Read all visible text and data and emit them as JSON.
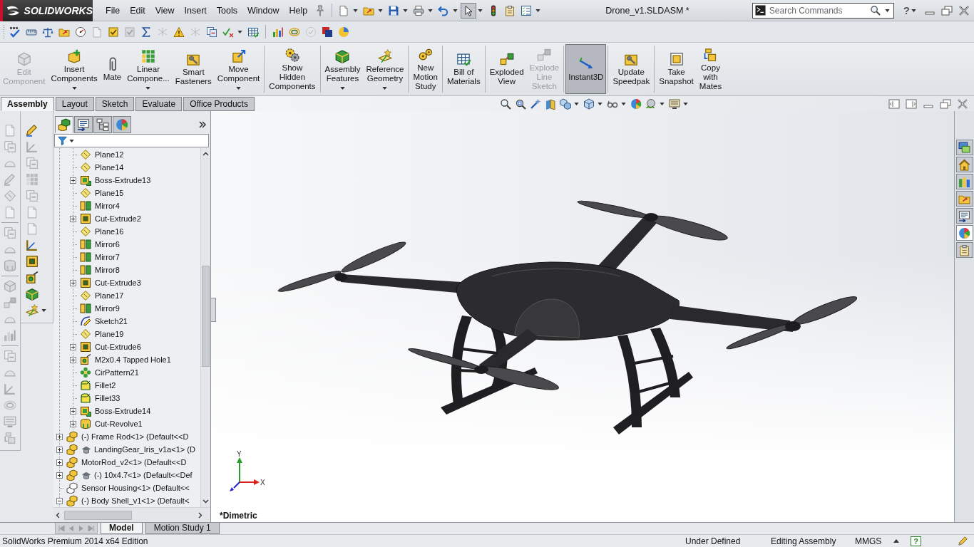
{
  "title_bar": {
    "logo": "SOLIDWORKS",
    "menu": [
      "File",
      "Edit",
      "View",
      "Insert",
      "Tools",
      "Window",
      "Help"
    ],
    "quick_access": [
      {
        "kind": "page",
        "dropdown": true,
        "selected": false
      },
      {
        "kind": "folder",
        "dropdown": true,
        "selected": false
      },
      {
        "kind": "floppy",
        "dropdown": true,
        "selected": false
      },
      {
        "kind": "printer",
        "dropdown": true,
        "selected": false
      },
      {
        "kind": "undo",
        "dropdown": true,
        "selected": false
      },
      {
        "kind": "cursor",
        "dropdown": true,
        "selected": true
      },
      {
        "kind": "lights",
        "dropdown": false,
        "selected": false
      },
      {
        "kind": "clipboard",
        "dropdown": false,
        "selected": false
      },
      {
        "kind": "checklist",
        "dropdown": true,
        "selected": false
      }
    ],
    "document_title": "Drone_v1.SLDASM *",
    "search": {
      "placeholder": "Search Commands"
    },
    "help": "?"
  },
  "toolbar": [
    [
      {
        "kind": "check",
        "disabled": false,
        "dropdown": false
      },
      {
        "kind": "ruler",
        "disabled": false,
        "dropdown": false
      },
      {
        "kind": "scale",
        "disabled": false,
        "dropdown": false
      },
      {
        "kind": "folder",
        "disabled": false,
        "dropdown": false
      },
      {
        "kind": "gauge",
        "disabled": false,
        "dropdown": false
      },
      {
        "kind": "page",
        "disabled": true,
        "dropdown": false
      },
      {
        "kind": "checkbox",
        "disabled": false,
        "dropdown": false
      },
      {
        "kind": "checkbox",
        "disabled": true,
        "dropdown": false
      },
      {
        "kind": "sigma",
        "disabled": false,
        "dropdown": false
      },
      {
        "kind": "lines",
        "disabled": true,
        "dropdown": false
      },
      {
        "kind": "warning",
        "disabled": false,
        "dropdown": false
      },
      {
        "kind": "lines",
        "disabled": true,
        "dropdown": false
      },
      {
        "kind": "pages",
        "disabled": false,
        "dropdown": false
      },
      {
        "kind": "checkx",
        "disabled": false,
        "dropdown": true
      },
      {
        "kind": "table",
        "disabled": false,
        "dropdown": false
      }
    ],
    [
      {
        "kind": "bars",
        "disabled": false,
        "dropdown": false
      },
      {
        "kind": "rings",
        "disabled": false,
        "dropdown": false
      },
      {
        "kind": "circle",
        "disabled": true,
        "dropdown": false
      },
      {
        "kind": "squares",
        "disabled": false,
        "dropdown": false
      },
      {
        "kind": "sphere",
        "disabled": false,
        "dropdown": false
      }
    ]
  ],
  "command_manager": {
    "groups": [
      [
        {
          "label": "Edit\nComponent",
          "kind": "cube",
          "disabled": true,
          "dropdown": false,
          "selected": false
        },
        {
          "label": "Insert\nComponents",
          "kind": "plus",
          "disabled": false,
          "dropdown": true,
          "selected": false
        },
        {
          "label": "Mate",
          "kind": "clip",
          "disabled": false,
          "dropdown": false,
          "selected": false
        },
        {
          "label": "Linear\nCompone...",
          "kind": "dots",
          "disabled": false,
          "dropdown": true,
          "selected": false
        },
        {
          "label": "Smart\nFasteners",
          "kind": "bolt",
          "disabled": false,
          "dropdown": false,
          "selected": false
        },
        {
          "label": "Move\nComponent",
          "kind": "move",
          "disabled": false,
          "dropdown": true,
          "selected": false
        }
      ],
      [
        {
          "label": "Show\nHidden\nComponents",
          "kind": "gears",
          "disabled": false,
          "dropdown": false,
          "selected": false
        }
      ],
      [
        {
          "label": "Assembly\nFeatures",
          "kind": "block",
          "disabled": false,
          "dropdown": true,
          "selected": false
        },
        {
          "label": "Reference\nGeometry",
          "kind": "star",
          "disabled": false,
          "dropdown": true,
          "selected": false
        }
      ],
      [
        {
          "label": "New\nMotion\nStudy",
          "kind": "wheels",
          "disabled": false,
          "dropdown": false,
          "selected": false
        }
      ],
      [
        {
          "label": "Bill of\nMaterials",
          "kind": "table",
          "disabled": false,
          "dropdown": false,
          "selected": false
        }
      ],
      [
        {
          "label": "Exploded\nView",
          "kind": "explode",
          "disabled": false,
          "dropdown": false,
          "selected": false
        },
        {
          "label": "Explode\nLine\nSketch",
          "kind": "explode",
          "disabled": true,
          "dropdown": false,
          "selected": false
        }
      ],
      [
        {
          "label": "Instant3D",
          "kind": "arrow",
          "disabled": false,
          "dropdown": false,
          "selected": true
        }
      ],
      [
        {
          "label": "Update\nSpeedpak",
          "kind": "bolt",
          "disabled": false,
          "dropdown": false,
          "selected": false
        }
      ],
      [
        {
          "label": "Take\nSnapshot",
          "kind": "snapshot",
          "disabled": false,
          "dropdown": false,
          "selected": false
        },
        {
          "label": "Copy\nwith\nMates",
          "kind": "copy",
          "disabled": false,
          "dropdown": false,
          "selected": false
        }
      ]
    ],
    "tabs": [
      {
        "label": "Assembly",
        "selected": true
      },
      {
        "label": "Layout",
        "selected": false
      },
      {
        "label": "Sketch",
        "selected": false
      },
      {
        "label": "Evaluate",
        "selected": false
      },
      {
        "label": "Office Products",
        "selected": false
      }
    ]
  },
  "vertical_toolbars": [
    {
      "groups": [
        [
          {
            "kind": "page",
            "disabled": true
          },
          {
            "kind": "pages",
            "disabled": true
          },
          {
            "kind": "dome",
            "disabled": true
          },
          {
            "kind": "pencil",
            "disabled": true
          },
          {
            "kind": "plane",
            "disabled": true
          },
          {
            "kind": "page",
            "disabled": true
          }
        ],
        [
          {
            "kind": "pages",
            "disabled": true
          },
          {
            "kind": "dome",
            "disabled": true
          },
          {
            "kind": "revolve",
            "disabled": true
          }
        ],
        [
          {
            "kind": "cube",
            "disabled": true
          },
          {
            "kind": "explode",
            "disabled": true
          },
          {
            "kind": "dome",
            "disabled": true
          },
          {
            "kind": "bars",
            "disabled": true
          }
        ],
        [
          {
            "kind": "pages",
            "disabled": true
          },
          {
            "kind": "dome",
            "disabled": true
          },
          {
            "kind": "axis",
            "disabled": true
          },
          {
            "kind": "rings",
            "disabled": true
          },
          {
            "kind": "monitor",
            "disabled": true
          },
          {
            "kind": "copy",
            "disabled": true
          }
        ]
      ]
    },
    {
      "groups": [
        [
          {
            "kind": "pencil",
            "disabled": false,
            "dropdown": false
          },
          {
            "kind": "axis",
            "disabled": true,
            "dropdown": false
          },
          {
            "kind": "pages",
            "disabled": true,
            "dropdown": false
          },
          {
            "kind": "dots",
            "disabled": true,
            "dropdown": false
          },
          {
            "kind": "pages",
            "disabled": true,
            "dropdown": false
          },
          {
            "kind": "page",
            "disabled": true,
            "dropdown": false
          },
          {
            "kind": "page",
            "disabled": true,
            "dropdown": false
          },
          {
            "kind": "axis",
            "disabled": false,
            "dropdown": false
          },
          {
            "kind": "cut",
            "disabled": false,
            "dropdown": false
          },
          {
            "kind": "hole",
            "disabled": false,
            "dropdown": false
          },
          {
            "kind": "block",
            "disabled": false,
            "dropdown": false
          },
          {
            "kind": "star",
            "disabled": false,
            "dropdown": true
          }
        ]
      ]
    }
  ],
  "feature_manager": {
    "tabs": [
      {
        "kind": "blocks",
        "selected": true
      },
      {
        "kind": "list",
        "selected": false
      },
      {
        "kind": "hierarchy",
        "selected": false
      },
      {
        "kind": "ball",
        "selected": false
      }
    ],
    "tree": [
      {
        "children": [
          {
            "label": "Plane12",
            "kind": "plane"
          },
          {
            "label": "Plane14",
            "kind": "plane"
          },
          {
            "label": "Boss-Extrude13",
            "kind": "extrude",
            "expanded": false
          },
          {
            "label": "Plane15",
            "kind": "plane"
          },
          {
            "label": "Mirror4",
            "kind": "mirror"
          },
          {
            "label": "Cut-Extrude2",
            "kind": "cut",
            "expanded": false
          },
          {
            "label": "Plane16",
            "kind": "plane"
          },
          {
            "label": "Mirror6",
            "kind": "mirror"
          },
          {
            "label": "Mirror7",
            "kind": "mirror"
          },
          {
            "label": "Mirror8",
            "kind": "mirror"
          },
          {
            "label": "Cut-Extrude3",
            "kind": "cut",
            "expanded": false
          },
          {
            "label": "Plane17",
            "kind": "plane"
          },
          {
            "label": "Mirror9",
            "kind": "mirror"
          },
          {
            "label": "Sketch21",
            "kind": "sketch"
          },
          {
            "label": "Plane19",
            "kind": "plane"
          },
          {
            "label": "Cut-Extrude6",
            "kind": "cut",
            "expanded": false
          },
          {
            "label": "M2x0.4 Tapped Hole1",
            "kind": "hole",
            "expanded": false
          },
          {
            "label": "CirPattern21",
            "kind": "pattern"
          },
          {
            "label": "Fillet2",
            "kind": "fillet"
          },
          {
            "label": "Fillet33",
            "kind": "fillet"
          },
          {
            "label": "Boss-Extrude14",
            "kind": "extrude",
            "expanded": false
          },
          {
            "label": "Cut-Revolve1",
            "kind": "revolve",
            "expanded": false
          }
        ]
      },
      {
        "label": "(-) Frame Rod<1> (Default<<D",
        "kind": "component",
        "expanded": false,
        "extra_icon": false
      },
      {
        "label": "LandingGear_Iris_v1a<1> (D",
        "kind": "component",
        "expanded": false,
        "extra_icon": true
      },
      {
        "label": "MotorRod_v2<1> (Default<<D",
        "kind": "component",
        "expanded": false,
        "extra_icon": false
      },
      {
        "label": "(-) 10x4.7<1> (Default<<Def",
        "kind": "component",
        "expanded": false,
        "extra_icon": true
      },
      {
        "label": "Sensor Housing<1> (Default<<",
        "kind": "outline",
        "extra_icon": false
      },
      {
        "label": "(-) Body Shell_v1<1> (Default<",
        "kind": "component",
        "expanded": true,
        "extra_icon": false
      }
    ],
    "bottom_tabs": [
      {
        "label": "Model",
        "selected": true
      },
      {
        "label": "Motion Study 1",
        "selected": false
      }
    ]
  },
  "graphics_area": {
    "view_toolbar": [
      {
        "kind": "magnifier",
        "dropdown": false
      },
      {
        "kind": "zoombox",
        "dropdown": false
      },
      {
        "kind": "wand",
        "dropdown": false
      },
      {
        "kind": "section",
        "dropdown": false
      },
      {
        "kind": "cubes",
        "dropdown": true
      },
      {
        "kind": "cube",
        "dropdown": true
      },
      {
        "kind": "glasses",
        "dropdown": true
      },
      {
        "kind": "ball",
        "dropdown": false
      },
      {
        "kind": "scene",
        "dropdown": true
      },
      {
        "kind": "monitor",
        "dropdown": true
      }
    ],
    "triad": {
      "y_label": "Y",
      "x_label": "X"
    },
    "view_name": "*Dimetric"
  },
  "task_pane": [
    {
      "kind": "windows",
      "selected": false
    },
    {
      "kind": "house",
      "selected": false
    },
    {
      "kind": "books",
      "selected": false
    },
    {
      "kind": "folder",
      "selected": false
    },
    {
      "kind": "list",
      "selected": false
    },
    {
      "kind": "ball",
      "selected": true
    },
    {
      "kind": "clipboard",
      "selected": false
    }
  ],
  "status_bar": {
    "product": "SolidWorks Premium 2014 x64 Edition",
    "fields": [
      "Under Defined",
      "Editing Assembly",
      "MMGS"
    ],
    "help": "?"
  }
}
